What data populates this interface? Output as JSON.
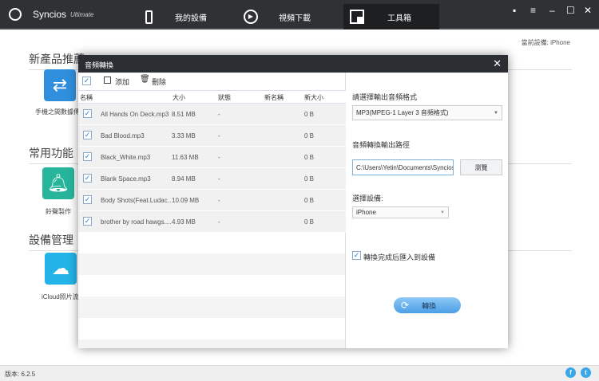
{
  "app": {
    "name": "Syncios",
    "edition": "Ultimate"
  },
  "nav": [
    {
      "label": "我的設備",
      "icon": "phone-icon"
    },
    {
      "label": "視頻下載",
      "icon": "play-icon"
    },
    {
      "label": "工具箱",
      "icon": "toolbox-icon",
      "active": true
    }
  ],
  "window_controls": [
    "message-icon",
    "menu-icon",
    "minimize-icon",
    "maximize-icon",
    "close-icon"
  ],
  "current_device": "當前設備: iPhone",
  "sections": [
    {
      "title": "新產品推薦",
      "apps": [
        {
          "label": "手機之間數據傳",
          "icon": "transfer-icon",
          "color": "#2f8fdc"
        }
      ]
    },
    {
      "title": "常用功能",
      "apps": [
        {
          "label": "鈴聲製作",
          "icon": "bell-icon",
          "color": "#26b59a"
        }
      ]
    },
    {
      "title": "設備管理",
      "apps": [
        {
          "label": "iCloud照片流",
          "icon": "cloud-icon",
          "color": "#23b3e8"
        }
      ]
    }
  ],
  "dialog": {
    "title": "音頻轉換",
    "toolbar": {
      "add": "添加",
      "delete": "刪除"
    },
    "columns": [
      "名稱",
      "大小",
      "狀態",
      "新名稱",
      "新大小"
    ],
    "files": [
      {
        "name": "All Hands On Deck.mp3",
        "size": "8.51 MB",
        "status": "-",
        "new_name": "",
        "new_size": "0 B",
        "checked": true
      },
      {
        "name": "Bad Blood.mp3",
        "size": "3.33 MB",
        "status": "-",
        "new_name": "",
        "new_size": "0 B",
        "checked": true
      },
      {
        "name": "Black_White.mp3",
        "size": "11.63 MB",
        "status": "-",
        "new_name": "",
        "new_size": "0 B",
        "checked": true
      },
      {
        "name": "Blank Space.mp3",
        "size": "8.94 MB",
        "status": "-",
        "new_name": "",
        "new_size": "0 B",
        "checked": true
      },
      {
        "name": "Body Shots(Feat.Ludac...",
        "size": "10.09 MB",
        "status": "-",
        "new_name": "",
        "new_size": "0 B",
        "checked": true
      },
      {
        "name": "brother by road hawgs....",
        "size": "4.93 MB",
        "status": "-",
        "new_name": "",
        "new_size": "0 B",
        "checked": true
      }
    ],
    "format_label": "請選擇輸出音頻格式",
    "format_value": "MP3(MPEG-1 Layer 3 音頻格式)",
    "path_label": "音頻轉換輸出路徑",
    "path_value": "C:\\Users\\Yetin\\Documents\\Syncios",
    "browse": "瀏覽",
    "device_label": "選擇設備:",
    "device_value": "iPhone",
    "import_label": "轉換完成后匯入到設備",
    "import_checked": true,
    "convert": "轉換"
  },
  "status": {
    "version": "版本: 6.2.5"
  }
}
